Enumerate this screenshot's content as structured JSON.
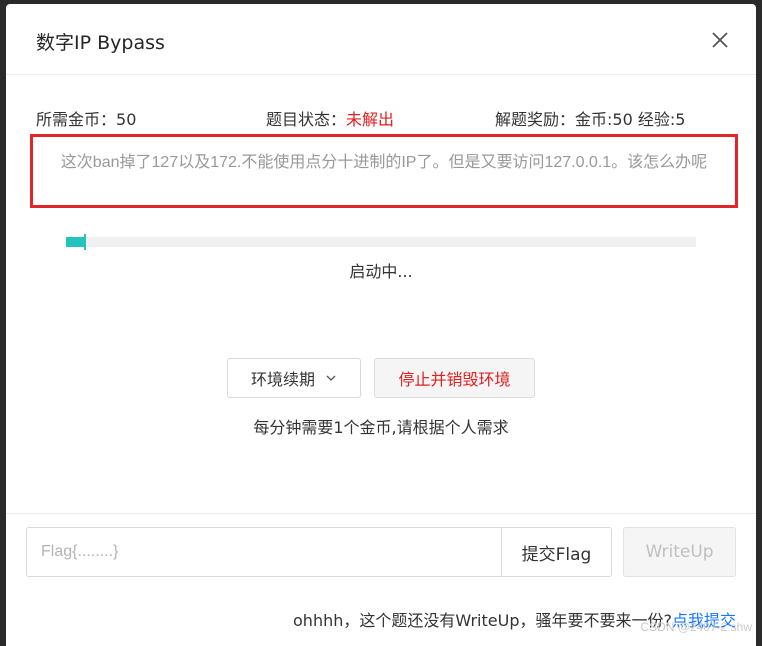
{
  "modal": {
    "title": "数字IP Bypass"
  },
  "info": {
    "cost_label": "所需金币：",
    "cost_value": "50",
    "status_label": "题目状态：",
    "status_value": "未解出",
    "reward_label": "解题奖励：",
    "reward_value": "金币:50 经验:5"
  },
  "description": "这次ban掉了127以及172.不能使用点分十进制的IP了。但是又要访问127.0.0.1。该怎么办呢",
  "progress": {
    "fraction": 0.03,
    "status_text": "启动中..."
  },
  "actions": {
    "renew_label": "环境续期",
    "stop_label": "停止并销毁环境",
    "cost_note": "每分钟需要1个金币,请根据个人需求"
  },
  "flag": {
    "placeholder": "Flag{........}",
    "value": "",
    "submit_label": "提交Flag",
    "writeup_label": "WriteUp"
  },
  "bottom": {
    "note": "ohhhh，这个题还没有WriteUp，骚年要不要来一份?",
    "link": "点我提交"
  },
  "watermark": "CSDN @2407-2 shw",
  "colors": {
    "accent": "#24c3bf",
    "danger": "#e02020",
    "link": "#1677ff"
  }
}
